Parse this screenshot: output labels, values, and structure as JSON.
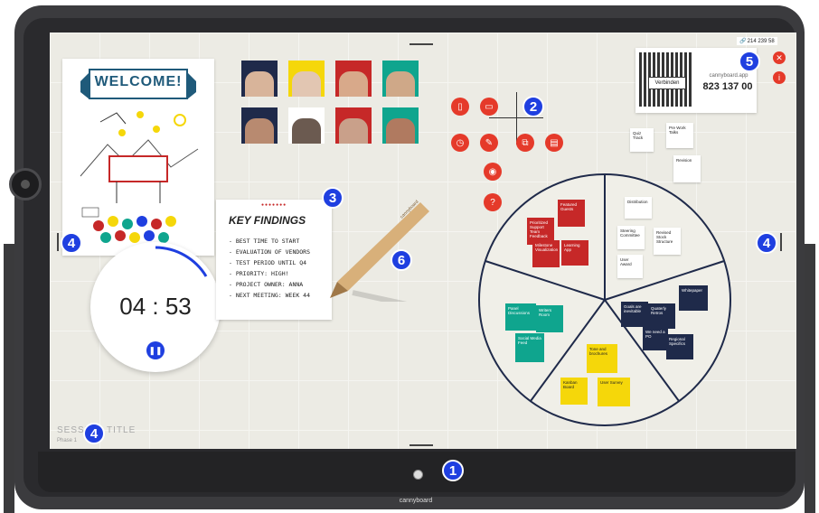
{
  "board": {
    "welcome_sign": "WELCOME!",
    "session_title": "SESSION TITLE",
    "session_phase": "Phase 1",
    "brand": "cannyboard"
  },
  "timer": {
    "display": "04 : 53",
    "pause_icon": "pause-icon",
    "progress": 0.15
  },
  "findings": {
    "title": "KEY FINDINGS",
    "lines": [
      "- BEST TIME TO START",
      "- EVALUATION OF VENDORS",
      "- TEST PERIOD UNTIL Q4",
      "- PRIORITY: HIGH!",
      "- PROJECT OWNER: ANNA",
      "- NEXT MEETING: WEEK 44"
    ]
  },
  "pencil_label": "cannyboard",
  "connect": {
    "button": "Verbinden",
    "url": "cannyboard.app",
    "code": "823 137 00",
    "session_id": "214 239 58"
  },
  "tools": [
    "door-icon",
    "presentation-icon",
    "clock-icon",
    "pen-icon",
    "screen-share-icon",
    "sticky-icon",
    "camera-icon",
    "help-icon"
  ],
  "badges": {
    "b1": "1",
    "b2": "2",
    "b3": "3",
    "b4": "4",
    "b5": "5",
    "b6": "6"
  },
  "right_notes": [
    "Quiz Track",
    "Pre Work Talks",
    "Revision"
  ],
  "pie_notes": {
    "red": [
      "Featured Guests",
      "Prioritized Support Team Feedback",
      "Milestone Visualization",
      "Learning App"
    ],
    "white": [
      "Distribution",
      "Steering Committee",
      "Revised Stock Structure",
      "User Award"
    ],
    "navy": [
      "Whitepaper",
      "Quaterly Retros",
      "Goals are inevitable",
      "We need a PO",
      "Regional Specifics"
    ],
    "yellow": [
      "Tone and brochures",
      "Kanban Board",
      "User Survey"
    ],
    "teal": [
      "Panel Discussions",
      "Writers Room",
      "Social Media Feed"
    ]
  },
  "colors": {
    "accent": "#1f3fe0",
    "tool_red": "#e53a2a",
    "bezel": "#3b3b3e",
    "canvas": "#ecebe4"
  }
}
